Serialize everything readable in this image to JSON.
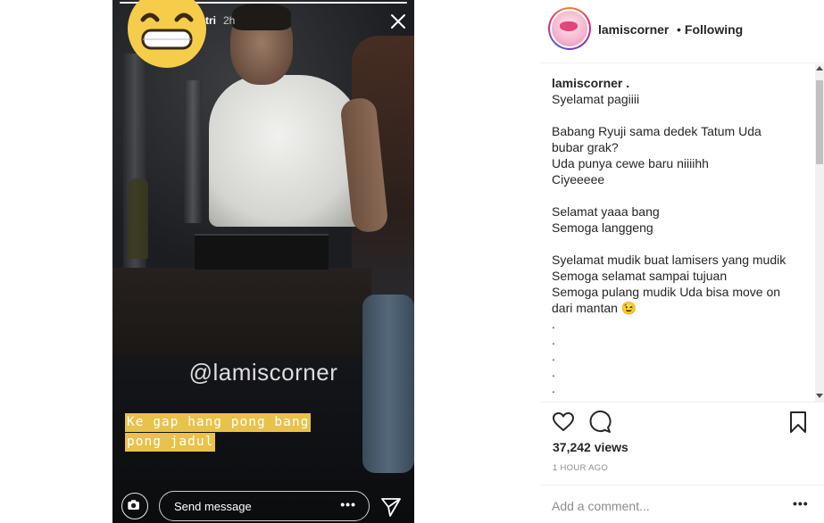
{
  "story": {
    "username": "tri",
    "time": "2h",
    "progress": 1.0,
    "watermark": "@lamiscorner",
    "caption_lines": [
      "Ke gap hang pong bang",
      "pong jadul"
    ],
    "send_placeholder": "Send message",
    "more": "•••"
  },
  "post": {
    "username": "lamiscorner",
    "separator": "•",
    "follow_status": "Following",
    "caption_user": "lamiscorner .",
    "caption": "Syelamat pagiiii\n\nBabang Ryuji sama dedek Tatum Uda\nbubar grak?\nUda punya cewe baru niiiihh\nCiyeeeee\n\nSelamat yaaa bang\nSemoga langgeng\n\nSyelamat mudik buat lamisers yang mudik\nSemoga selamat sampai tujuan\nSemoga pulang mudik Uda bisa move on\ndari mantan 😉\n.\n.\n.\n.\n.",
    "views": "37,242 views",
    "time_ago": "1 HOUR AGO",
    "comment_placeholder": "Add a comment...",
    "more": "•••"
  },
  "icons": {
    "close": "close-icon",
    "camera": "camera-icon",
    "share": "paper-plane-icon",
    "like": "heart-icon",
    "comment": "speech-bubble-icon",
    "save": "bookmark-icon",
    "sticker": "grinning-emoji-sticker"
  },
  "colors": {
    "caption_highlight": "#e8c24a",
    "text": "#262626",
    "muted": "#8e8e8e",
    "divider": "#efefef"
  }
}
